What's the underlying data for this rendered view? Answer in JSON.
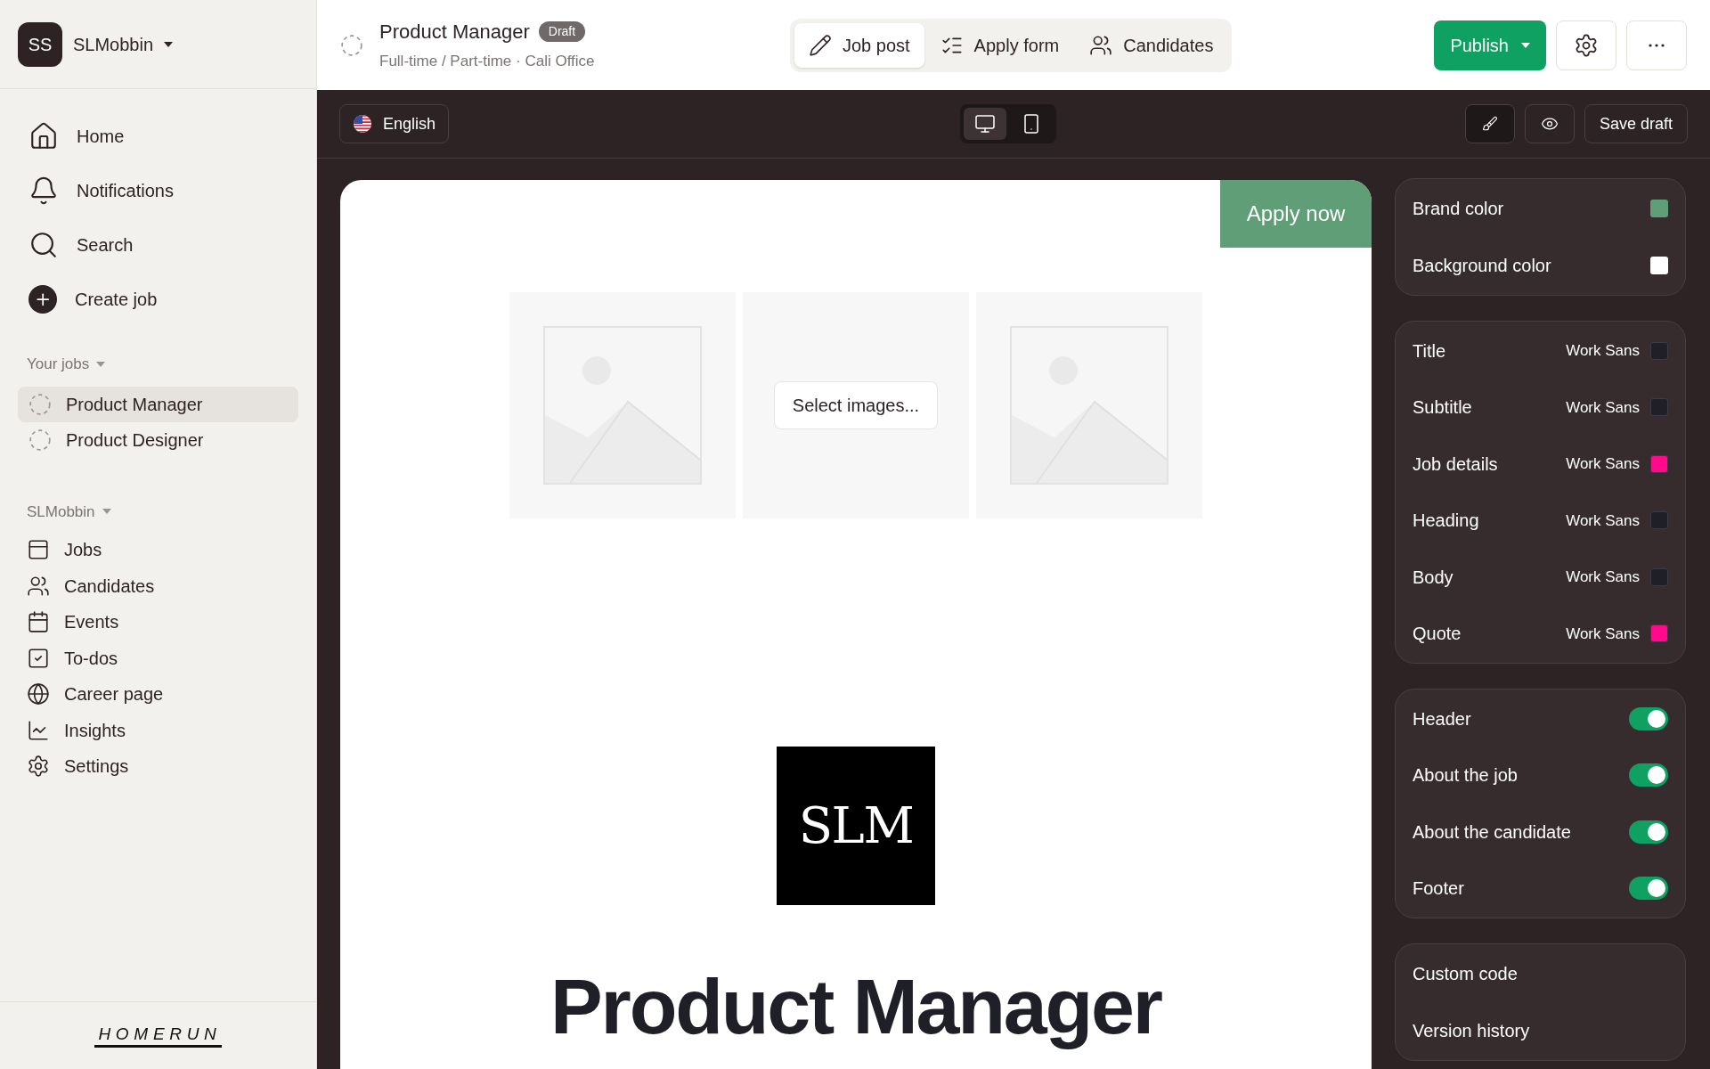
{
  "workspace": {
    "avatar": "SS",
    "name": "SLMobbin"
  },
  "nav": [
    {
      "label": "Home"
    },
    {
      "label": "Notifications"
    },
    {
      "label": "Search"
    },
    {
      "label": "Create job"
    }
  ],
  "your_jobs": {
    "heading": "Your jobs",
    "items": [
      {
        "label": "Product Manager",
        "selected": true
      },
      {
        "label": "Product Designer",
        "selected": false
      }
    ]
  },
  "org": {
    "heading": "SLMobbin",
    "items": [
      {
        "label": "Jobs"
      },
      {
        "label": "Candidates"
      },
      {
        "label": "Events"
      },
      {
        "label": "To-dos"
      },
      {
        "label": "Career page"
      },
      {
        "label": "Insights"
      },
      {
        "label": "Settings"
      }
    ]
  },
  "footer_logo": "HOMERUN",
  "header": {
    "title": "Product Manager",
    "badge": "Draft",
    "subtitle": "Full-time / Part-time · Cali Office",
    "tabs": [
      {
        "label": "Job post",
        "selected": true
      },
      {
        "label": "Apply form",
        "selected": false
      },
      {
        "label": "Candidates",
        "selected": false
      }
    ],
    "publish": "Publish"
  },
  "toolbar": {
    "language": "English",
    "devices": [
      {
        "kind": "desktop",
        "selected": true
      },
      {
        "kind": "mobile",
        "selected": false
      }
    ],
    "save": "Save draft"
  },
  "preview": {
    "apply": "Apply now",
    "select_images": "Select images...",
    "logo": "SLM",
    "title": "Product Manager"
  },
  "colors": [
    {
      "label": "Brand color",
      "color": "#5f9e77"
    },
    {
      "label": "Background color",
      "color": "#ffffff"
    }
  ],
  "fonts": [
    {
      "label": "Title",
      "font": "Work Sans",
      "color": "#1f1f27"
    },
    {
      "label": "Subtitle",
      "font": "Work Sans",
      "color": "#1f1f27"
    },
    {
      "label": "Job details",
      "font": "Work Sans",
      "color": "#ff0a8c"
    },
    {
      "label": "Heading",
      "font": "Work Sans",
      "color": "#1f1f27"
    },
    {
      "label": "Body",
      "font": "Work Sans",
      "color": "#1f1f27"
    },
    {
      "label": "Quote",
      "font": "Work Sans",
      "color": "#ff0a8c"
    }
  ],
  "sections": [
    {
      "label": "Header",
      "on": true
    },
    {
      "label": "About the job",
      "on": true
    },
    {
      "label": "About the candidate",
      "on": true
    },
    {
      "label": "Footer",
      "on": true
    }
  ],
  "more": [
    "Custom code",
    "Version history"
  ]
}
